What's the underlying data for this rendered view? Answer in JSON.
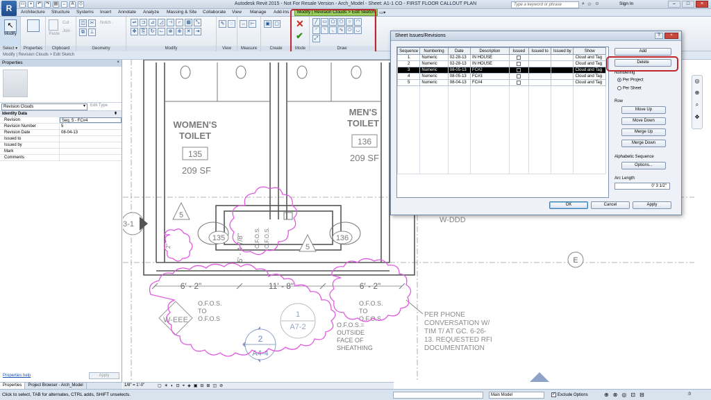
{
  "app": {
    "title": "Autodesk Revit 2015 - Not For Resale Version -     Arch_Model - Sheet: A1-1 CO - FIRST FLOOR CALLOUT PLAN",
    "logo": "R",
    "search_placeholder": "Type a keyword or phrase",
    "signin": "Sign In",
    "colors": {
      "accent": "#9ccf60",
      "highlight": "#c0262d",
      "cloud": "#e05ae0"
    }
  },
  "tabs": [
    "Architecture",
    "Structure",
    "Systems",
    "Insert",
    "Annotate",
    "Analyze",
    "Massing & Site",
    "Collaborate",
    "View",
    "Manage",
    "Add-Ins"
  ],
  "active_tab": "Modify | Revision Clouds > Edit Sketch",
  "ribbon": {
    "modify_label": "Modify",
    "select_label": "Select ▾",
    "properties_label": "Properties",
    "clipboard": {
      "label": "Clipboard",
      "paste": "Paste",
      "cut": "Cut ·",
      "join": "Join ·"
    },
    "geometry": {
      "label": "Geometry",
      "notch": "Notch ·"
    },
    "modify_panel": "Modify",
    "view_panel": "View",
    "measure_panel": "Measure",
    "create_panel": "Create",
    "mode_panel": "Mode",
    "draw_panel": "Draw"
  },
  "options_bar": "Modify | Revision Clouds > Edit Sketch",
  "properties": {
    "header": "Properties",
    "type": "Revision Clouds",
    "edit_type": "Edit Type",
    "category": "Identity Data",
    "rows": [
      {
        "k": "Revision",
        "v": "Seq. 5 - FC#4"
      },
      {
        "k": "Revision Number",
        "v": "5"
      },
      {
        "k": "Revision Date",
        "v": "08-04-13"
      },
      {
        "k": "Issued to",
        "v": ""
      },
      {
        "k": "Issued by",
        "v": ""
      },
      {
        "k": "Mark",
        "v": ""
      },
      {
        "k": "Comments",
        "v": ""
      }
    ],
    "help": "Properties help",
    "apply": "Apply"
  },
  "panel_tabs": [
    "Properties",
    "Project Browser - Arch_Model"
  ],
  "canvas": {
    "womens": [
      "WOMEN'S",
      "TOILET"
    ],
    "womens_num": "135",
    "womens_sf": "209 SF",
    "mens": [
      "MEN'S",
      "TOILET"
    ],
    "mens_num": "136",
    "mens_sf": "209 SF",
    "tag135": "135",
    "tag136": "136",
    "rev5": "5",
    "dim1": "6' - 2\"",
    "dim2": "11' - 8\"",
    "dim3": "6' - 2\"",
    "ofos": [
      "O.F.O.S.",
      "TO",
      "O.F.O.S"
    ],
    "ofos2": [
      "O.F.O.S.",
      "TO",
      "O.F.O.S"
    ],
    "ofos3": [
      "O.F.O.S.=",
      "OUTSIDE",
      "FACE OF",
      "SHEATHING"
    ],
    "rot_ofos": "O.F.O.S.",
    "rot_dim": "5' - 4 7/8\"",
    "note": [
      "PER PHONE",
      "CONVERSATION W/",
      "TIM T/ AT GC. 6-26-",
      "13. REQUESTED RFI",
      "DOCUMENTATION"
    ],
    "grid_e": "E",
    "w_eee": "W-EEE",
    "w_ddd": "W-DDD",
    "a72": "A7-2",
    "a44": "A4-4",
    "a44_num": "2",
    "a72_num": "1",
    "left_tag": "3-1",
    "small_tag": "5",
    "rot_2": "2\""
  },
  "view_control": {
    "scale": "1/8\" = 1'-0\""
  },
  "statusbar": {
    "text": "Click to select, TAB for alternates, CTRL adds, SHIFT unselects.",
    "model": "Main Model",
    "exclude": "Exclude Options",
    "filter": ":0"
  },
  "dialog": {
    "title": "Sheet Issues/Revisions",
    "columns": [
      "Sequence",
      "Numbering",
      "Date",
      "Description",
      "Issued",
      "Issued to",
      "Issued by",
      "Show"
    ],
    "rows": [
      {
        "seq": "1",
        "num": "Numeric",
        "date": "02-28-13",
        "desc": "IN HOUSE",
        "show": "Cloud and Tag"
      },
      {
        "seq": "2",
        "num": "Numeric",
        "date": "02-28-13",
        "desc": "IN HOUSE",
        "show": "Cloud and Tag"
      },
      {
        "seq": "3",
        "num": "Numeric",
        "date": "08-05-13",
        "desc": "FC#2",
        "show": "Cloud and Tag"
      },
      {
        "seq": "4",
        "num": "Numeric",
        "date": "08-05-13",
        "desc": "FC#3",
        "show": "Cloud and Tag"
      },
      {
        "seq": "5",
        "num": "Numeric",
        "date": "08-04-13",
        "desc": "FC#4",
        "show": "Cloud and Tag"
      }
    ],
    "selected_row": 2,
    "add": "Add",
    "delete": "Delete",
    "numbering_label": "Numbering",
    "per_project": "Per Project",
    "per_sheet": "Per Sheet",
    "row_label": "Row",
    "move_up": "Move Up",
    "move_down": "Move Down",
    "merge_up": "Merge Up",
    "merge_down": "Merge Down",
    "alpha_label": "Alphabetic Sequence",
    "options": "Options...",
    "arc_label": "Arc Length",
    "arc_value": "0'  3 1/2\"",
    "ok": "OK",
    "cancel": "Cancel",
    "apply": "Apply"
  }
}
